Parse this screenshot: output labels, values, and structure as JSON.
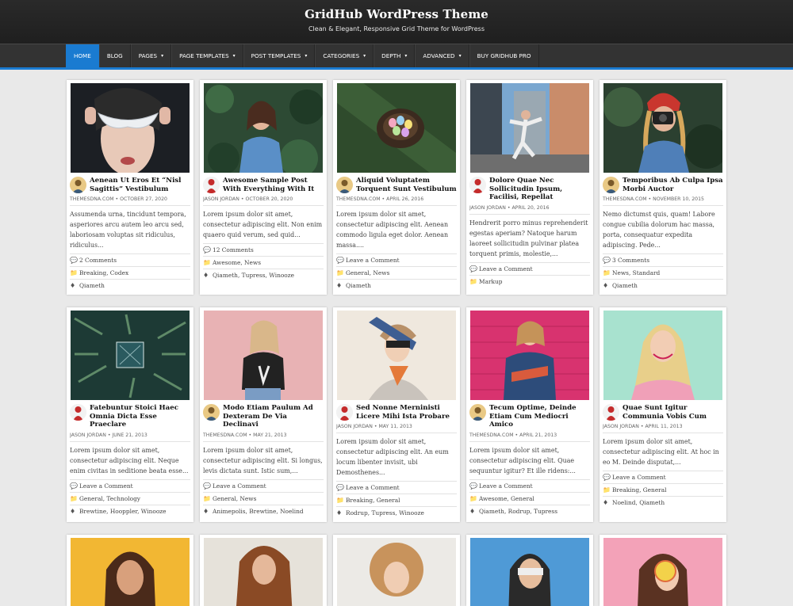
{
  "site": {
    "title": "GridHub WordPress Theme",
    "description": "Clean & Elegant, Responsive Grid Theme for WordPress"
  },
  "nav": [
    {
      "label": "Home",
      "dropdown": false,
      "active": true
    },
    {
      "label": "Blog",
      "dropdown": false
    },
    {
      "label": "Pages",
      "dropdown": true
    },
    {
      "label": "Page Templates",
      "dropdown": true
    },
    {
      "label": "Post Templates",
      "dropdown": true
    },
    {
      "label": "Categories",
      "dropdown": true
    },
    {
      "label": "Depth",
      "dropdown": true
    },
    {
      "label": "Advanced",
      "dropdown": true
    },
    {
      "label": "Buy GridHub Pro",
      "dropdown": false
    }
  ],
  "colors": {
    "accent": "#1a7bd1",
    "header": "#252525",
    "nav": "#333333"
  },
  "icons": {
    "comments": "comments-icon",
    "category": "folder-icon",
    "tag": "tag-icon"
  },
  "posts": [
    {
      "title": "Aenean Ut Eros Et “Nisl Sagittis” Vestibulum",
      "author": "THEMESDNA.COM",
      "date": "OCTOBER 27, 2020",
      "excerpt": "Assumenda urna, tincidunt tempora, asperiores arcu autem leo arcu sed, laboriosam voluptas sit ridiculus, ridiculus...",
      "comments": "2 Comments",
      "categories": "Breaking, Codex",
      "tags": "Qiameth",
      "image": "mask-portrait",
      "avatar": "yellow"
    },
    {
      "title": "Awesome Sample Post With Everything With It",
      "author": "JASON JORDAN",
      "date": "OCTOBER 20, 2020",
      "excerpt": "Lorem ipsum dolor sit amet, consectetur adipiscing elit. Non enim quaero quid verum, sed quid...",
      "comments": "12 Comments",
      "categories": "Awesome, News",
      "tags": "Qiameth, Tupress, Winooze",
      "image": "woman-greenery",
      "avatar": "red"
    },
    {
      "title": "Aliquid Voluptatem Torquent Sunt Vestibulum",
      "author": "THEMESDNA.COM",
      "date": "APRIL 26, 2016",
      "excerpt": "Lorem ipsum dolor sit amet, consectetur adipiscing elit. Aenean commodo ligula eget dolor. Aenean massa....",
      "comments": "Leave a Comment",
      "categories": "General, News",
      "tags": "Qiameth",
      "image": "easter-eggs",
      "avatar": "yellow"
    },
    {
      "title": "Dolore Quae Nec Sollicitudin Ipsum, Facilisi, Repellat",
      "author": "JASON JORDAN",
      "date": "APRIL 20, 2016",
      "excerpt": "Hendrerit porro minus reprehenderit egestas aperiam? Natoque harum laoreet sollicitudin pulvinar platea torquent primis, molestie,...",
      "comments": "Leave a Comment",
      "categories": "Markup",
      "tags": "",
      "image": "dancer-city",
      "avatar": "red"
    },
    {
      "title": "Temporibus Ab Culpa Ipsa Morbi Auctor",
      "author": "THEMESDNA.COM",
      "date": "NOVEMBER 10, 2015",
      "excerpt": "Nemo dictumst quis, quam! Labore congue cubilia dolorum hac massa, porta, consequatur expedita adipiscing. Pede...",
      "comments": "3 Comments",
      "categories": "News, Standard",
      "tags": "Qiameth",
      "image": "photographer",
      "avatar": "yellow"
    },
    {
      "title": "Fatebuntur Stoici Haec Omnia Dicta Esse Praeclare",
      "author": "JASON JORDAN",
      "date": "JUNE 21, 2013",
      "excerpt": "Lorem ipsum dolor sit amet, consectetur adipiscing elit. Neque enim civitas in seditione beata esse...",
      "comments": "Leave a Comment",
      "categories": "General, Technology",
      "tags": "Brewtine, Hooppler, Winooze",
      "image": "pine-frame",
      "avatar": "red"
    },
    {
      "title": "Modo Etiam Paulum Ad Dexteram De Via Declinavi",
      "author": "THEMESDNA.COM",
      "date": "MAY 21, 2013",
      "excerpt": "Lorem ipsum dolor sit amet, consectetur adipiscing elit. Si longus, levis dictata sunt. Istic sum,...",
      "comments": "Leave a Comment",
      "categories": "General, News",
      "tags": "Animepolis, Brewtine, Noelind",
      "image": "pink-wall",
      "avatar": "yellow"
    },
    {
      "title": "Sed Nonne Merninisti Licere Mihi Ista Probare",
      "author": "JASON JORDAN",
      "date": "MAY 11, 2013",
      "excerpt": "Lorem ipsum dolor sit amet, consectetur adipiscing elit. An eum locum libenter invisit, ubi Demosthenes...",
      "comments": "Leave a Comment",
      "categories": "Breaking, General",
      "tags": "Rodrup, Tupress, Winooze",
      "image": "glasses-woman",
      "avatar": "red"
    },
    {
      "title": "Tecum Optime, Deinde Etiam Cum Mediocri Amico",
      "author": "THEMESDNA.COM",
      "date": "APRIL 21, 2013",
      "excerpt": "Lorem ipsum dolor sit amet, consectetur adipiscing elit. Quae sequuntur igitur? Et ille ridens:...",
      "comments": "Leave a Comment",
      "categories": "Awesome, General",
      "tags": "Qiameth, Rodrup, Tupress",
      "image": "magenta-wall",
      "avatar": "yellow"
    },
    {
      "title": "Quae Sunt Igitur Communia Vobis Cum",
      "author": "JASON JORDAN",
      "date": "APRIL 11, 2013",
      "excerpt": "Lorem ipsum dolor sit amet, consectetur adipiscing elit. At hoc in eo M. Deinde disputat,...",
      "comments": "Leave a Comment",
      "categories": "Breaking, General",
      "tags": "Noelind, Qiameth",
      "image": "blonde-mint",
      "avatar": "red"
    }
  ],
  "partial_images": [
    "yellow-bg",
    "brown-hair",
    "curly-hair",
    "blue-sunglasses",
    "pink-lollipop"
  ]
}
